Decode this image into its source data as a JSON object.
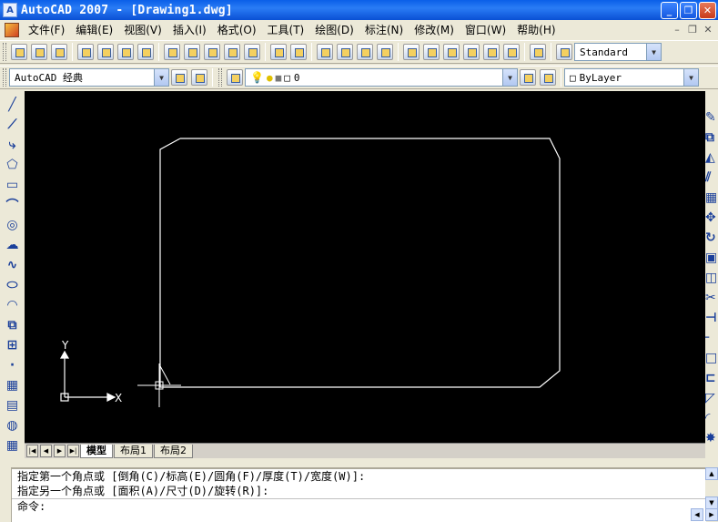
{
  "window": {
    "title": "AutoCAD 2007 - [Drawing1.dwg]"
  },
  "menu": [
    "文件(F)",
    "编辑(E)",
    "视图(V)",
    "插入(I)",
    "格式(O)",
    "工具(T)",
    "绘图(D)",
    "标注(N)",
    "修改(M)",
    "窗口(W)",
    "帮助(H)"
  ],
  "style_toolbar": {
    "text_style": "Standard"
  },
  "workspace": {
    "name": "AutoCAD 经典"
  },
  "layer": {
    "current": "0"
  },
  "properties": {
    "color": "ByLayer"
  },
  "tabs": {
    "model": "模型",
    "layout1": "布局1",
    "layout2": "布局2"
  },
  "ucs": {
    "x_label": "X",
    "y_label": "Y"
  },
  "command": {
    "line1": "指定第一个角点或 [倒角(C)/标高(E)/圆角(F)/厚度(T)/宽度(W)]:",
    "line2": "指定另一个角点或 [面积(A)/尺寸(D)/旋转(R)]:",
    "prompt": "命令:"
  },
  "colors": {
    "canvas": "#000000",
    "drawing_line": "#ffffff",
    "title_bar": "#0a5fe8"
  }
}
